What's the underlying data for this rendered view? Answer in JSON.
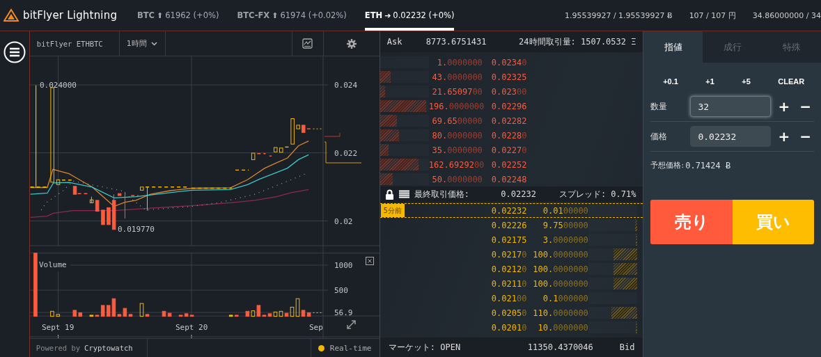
{
  "header": {
    "logo": "bitFlyer Lightning",
    "tickers": [
      {
        "symbol": "BTC",
        "arrow": "⬆",
        "price": "61962",
        "change": "(+0%)",
        "selected": false
      },
      {
        "symbol": "BTC-FX",
        "arrow": "⬆",
        "price": "61974",
        "change": "(+0.02%)",
        "selected": false
      },
      {
        "symbol": "ETH",
        "arrow": "➔",
        "price": "0.02232",
        "change": "(+0%)",
        "selected": true
      }
    ],
    "balances": [
      "1.95539927 / 1.95539927 Ƀ",
      "107 / 107 円",
      "34.86000000 / 34"
    ]
  },
  "chart": {
    "pair": "bitFlyer ETHBTC",
    "interval": "1時間",
    "price_axis": [
      "0.024",
      "0.022",
      "0.02"
    ],
    "high_label": "0.024000",
    "low_label": "0.019770",
    "volume_label": "Volume",
    "volume_axis": [
      "1000",
      "500",
      "56.9"
    ],
    "time_axis": [
      "Sept 19",
      "Sept 20",
      "Sep"
    ],
    "powered_by": "Powered by",
    "provider": "Cryptowatch",
    "feed": "Real-time"
  },
  "order_book": {
    "ask_label": "Ask",
    "ask_total": "8773.6751431",
    "volume_24h": "24時間取引量: 1507.0532 Ξ",
    "asks": [
      {
        "size": [
          "1.",
          "0000000"
        ],
        "price": [
          "0.0234",
          "0"
        ],
        "level": 0
      },
      {
        "size": [
          "43.",
          "0000000"
        ],
        "price": [
          "0.02325"
        ],
        "level": 0.21
      },
      {
        "size": [
          "21.65097",
          "00"
        ],
        "price": [
          "0.023",
          "00"
        ],
        "level": 0.1
      },
      {
        "size": [
          "196.",
          "0000000"
        ],
        "price": [
          "0.02296"
        ],
        "level": 0.94
      },
      {
        "size": [
          "69.65",
          "00000"
        ],
        "price": [
          "0.02282"
        ],
        "level": 0.34
      },
      {
        "size": [
          "80.",
          "0000000"
        ],
        "price": [
          "0.0228",
          "0"
        ],
        "level": 0.39
      },
      {
        "size": [
          "35.",
          "0000000"
        ],
        "price": [
          "0.0227",
          "0"
        ],
        "level": 0.18
      },
      {
        "size": [
          "162.69292",
          "00"
        ],
        "price": [
          "0.02252"
        ],
        "level": 0.79
      },
      {
        "size": [
          "50.",
          "0000000"
        ],
        "price": [
          "0.02248"
        ],
        "level": 0.26
      }
    ],
    "last_price_label": "最終取引価格:",
    "last_price": "0.02232",
    "spread": "スプレッド: 0.71%",
    "bids": [
      {
        "price": [
          "0.02232"
        ],
        "size": [
          "0.01",
          "00000"
        ],
        "level": 0,
        "badge": "5分前"
      },
      {
        "price": [
          "0.02226"
        ],
        "size": [
          "9.75",
          "00000"
        ],
        "level": 0.04
      },
      {
        "price": [
          "0.02175"
        ],
        "size": [
          "3.",
          "0000000"
        ],
        "level": 0.02
      },
      {
        "price": [
          "0.0217",
          "0"
        ],
        "size": [
          "100.",
          "0000000"
        ],
        "level": 0.48
      },
      {
        "price": [
          "0.0212",
          "0"
        ],
        "size": [
          "100.",
          "0000000"
        ],
        "level": 0.48
      },
      {
        "price": [
          "0.0211",
          "0"
        ],
        "size": [
          "100.",
          "0000000"
        ],
        "level": 0.48
      },
      {
        "price": [
          "0.021",
          "00"
        ],
        "size": [
          "0.1",
          "000000"
        ],
        "level": 0
      },
      {
        "price": [
          "0.0205",
          "0"
        ],
        "size": [
          "110.",
          "0000000"
        ],
        "level": 0.52
      },
      {
        "price": [
          "0.0201",
          "0"
        ],
        "size": [
          "10.",
          "0000000"
        ],
        "level": 0.03
      }
    ],
    "market_status": "マーケット: OPEN",
    "bid_total": "11350.4370046",
    "bid_label": "Bid"
  },
  "order_form": {
    "tabs": [
      {
        "label": "指値",
        "selected": true
      },
      {
        "label": "成行",
        "selected": false
      },
      {
        "label": "特殊",
        "selected": false
      }
    ],
    "quick_amounts": [
      "+0.1",
      "+1",
      "+5",
      "CLEAR"
    ],
    "fields": [
      {
        "label": "数量",
        "value": "32",
        "focused": true,
        "increment": "+",
        "decrement": "−"
      },
      {
        "label": "価格",
        "value": "0.02232",
        "focused": false,
        "increment": "+",
        "decrement": "−"
      }
    ],
    "estimate_label": "予想価格:",
    "estimate": "0.71424 Ƀ",
    "sell": "売り",
    "buy": "買い"
  }
}
